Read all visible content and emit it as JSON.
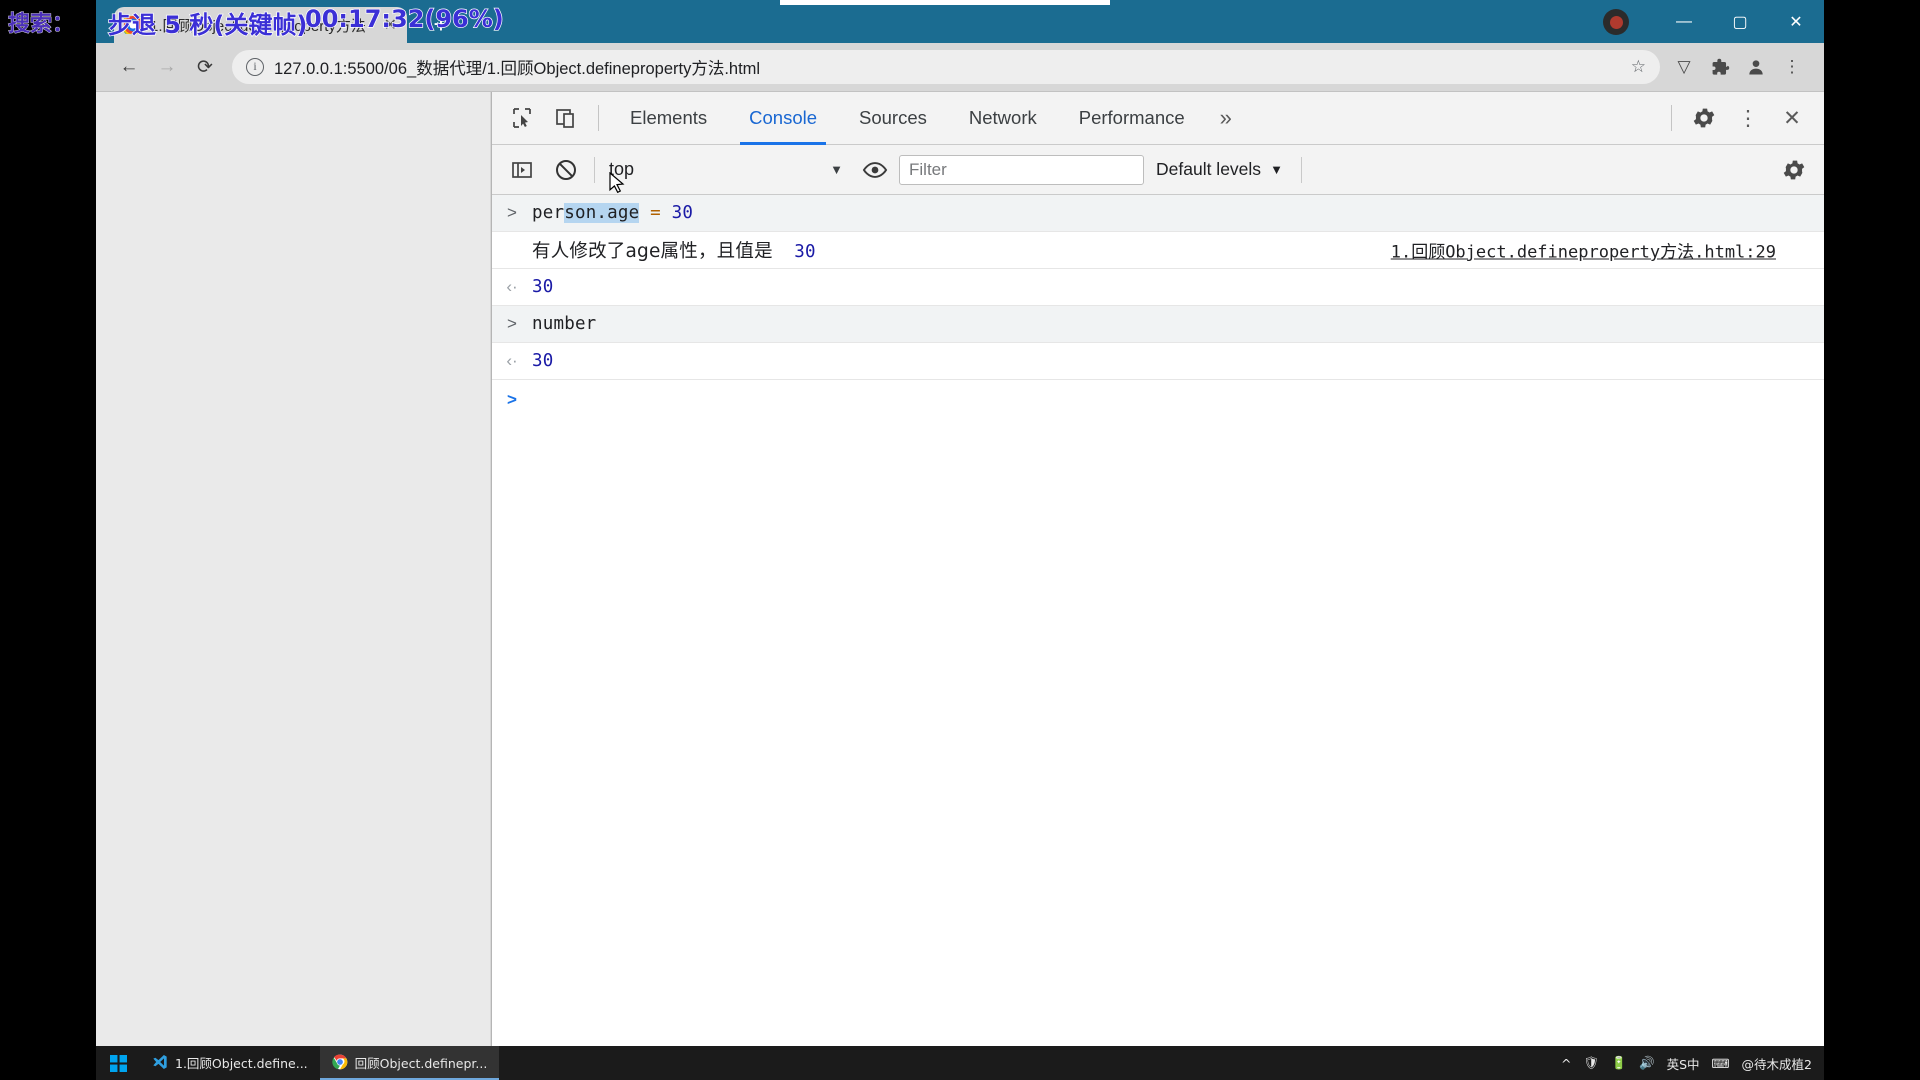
{
  "overlay": {
    "search_label": "搜索：",
    "step_label": "步退 5 秒(关键帧)",
    "timecode": "00:17:32(96%)"
  },
  "browser": {
    "tab": {
      "title": "1.回顾Object.defineproperty方法",
      "favicon_name": "chrome-favicon",
      "close_label": "✕"
    },
    "newtab_label": "+",
    "window_controls": {
      "minimize": "—",
      "maximize": "▢",
      "close": "✕"
    },
    "nav": {
      "back": "←",
      "forward": "→",
      "reload": "⟳"
    },
    "omnibox": {
      "info_glyph": "i",
      "url": "127.0.0.1:5500/06_数据代理/1.回顾Object.defineproperty方法.html",
      "star": "☆"
    },
    "toolbar_icons": [
      {
        "name": "vimium-extension-icon",
        "glyph": "▽"
      },
      {
        "name": "puzzle-extensions-icon",
        "glyph": "🧩"
      },
      {
        "name": "profile-avatar-icon",
        "glyph": "👤"
      },
      {
        "name": "chrome-menu-icon",
        "glyph": "⋮"
      }
    ]
  },
  "devtools": {
    "inspect_icon": "inspect-element-icon",
    "device_icon": "device-toolbar-icon",
    "tabs": [
      {
        "label": "Elements",
        "active": false
      },
      {
        "label": "Console",
        "active": true
      },
      {
        "label": "Sources",
        "active": false
      },
      {
        "label": "Network",
        "active": false
      },
      {
        "label": "Performance",
        "active": false
      }
    ],
    "more_tabs": "»",
    "settings_icon": "gear-icon",
    "kebab_icon": "⋮",
    "close_icon": "✕",
    "filterbar": {
      "sidebar_toggle": "console-sidebar-icon",
      "clear_icon": "clear-console-icon",
      "context": "top",
      "context_caret": "▼",
      "eye_icon": "live-expression-icon",
      "filter_placeholder": "Filter",
      "filter_value": "",
      "levels_label": "Default levels",
      "levels_caret": "▼",
      "settings_icon": "console-settings-icon"
    },
    "console_rows": [
      {
        "kind": "command",
        "icon": ">",
        "pre": "per",
        "selected": "son.age",
        "post": "",
        "op": "=",
        "num": "30",
        "source": ""
      },
      {
        "kind": "log",
        "icon": "",
        "text": "有人修改了age属性，且值是",
        "num": "30",
        "source": "1.回顾Object.defineproperty方法.html:29"
      },
      {
        "kind": "result",
        "icon": "‹·",
        "text": "",
        "num": "30",
        "source": ""
      },
      {
        "kind": "command",
        "icon": ">",
        "text": "number",
        "num": "",
        "source": ""
      },
      {
        "kind": "result",
        "icon": "‹·",
        "text": "",
        "num": "30",
        "source": ""
      },
      {
        "kind": "prompt",
        "icon": ">",
        "text": "",
        "num": "",
        "source": ""
      }
    ]
  },
  "taskbar": {
    "start_icon": "windows-start-icon",
    "tasks": [
      {
        "name": "vscode-task",
        "label": "1.回顾Object.define...",
        "icon": "vscode-icon"
      },
      {
        "name": "chrome-task",
        "label": "回顾Object.definepr...",
        "icon": "chrome-icon"
      }
    ],
    "tray": [
      {
        "name": "show-hidden-icons",
        "label": "^"
      },
      {
        "name": "security-icon",
        "label": "🛡"
      },
      {
        "name": "battery-icon",
        "label": "🔋"
      },
      {
        "name": "volume-icon",
        "label": "🔊"
      },
      {
        "name": "ime-indicator",
        "label": "英S中"
      },
      {
        "name": "ime-tray-icon",
        "label": "⌨"
      }
    ],
    "watermark": "@待木成植2"
  },
  "colors": {
    "tabstrip": "#1b6c91",
    "devtools_accent": "#1a73e8",
    "console_number": "#1a1aa6",
    "console_operator": "#b06000",
    "selection": "#b5d5f0",
    "overlay_text": "#3b2fd6"
  }
}
